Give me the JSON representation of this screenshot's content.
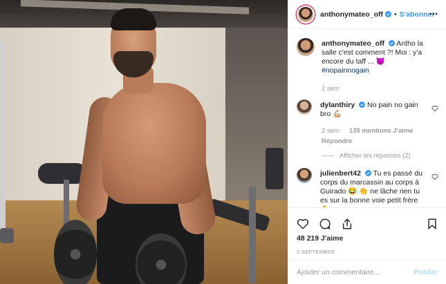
{
  "post": {
    "author": "anthonymateo_off",
    "dot": "•",
    "follow_label": "S'abonner",
    "caption": {
      "user": "anthonymateo_off",
      "text": "Antho la salle c'est comment ?! Moi : y'a encore du taff ... 😈",
      "hashtag": "#nopainnogain",
      "time": "2 sem"
    },
    "comments": [
      {
        "user": "dylanthiry",
        "text": "No pain no gain bro 💪🏼",
        "time": "2 sem",
        "likes": "135 mentions J'aime",
        "reply_label": "Répondre",
        "replies_label": "Afficher les réponses (2)"
      },
      {
        "user": "julienbert42",
        "text": "Tu es passé du corps du marcassin au corps à Guirado 😂 👏 ne lâche rien tu es sur la bonne voie petit frère 💪"
      }
    ],
    "likes": "48 219 J'aime",
    "date": "3 SEPTEMBRE",
    "add_comment_placeholder": "Ajouter un commentaire...",
    "publish_label": "Publier",
    "colors": {
      "accent": "#3897f0",
      "publish_disabled": "#b2dffc",
      "muted": "#999999",
      "hashtag": "#003569"
    },
    "icons": [
      "more-icon",
      "verified-icon",
      "heart-icon",
      "comment-icon",
      "share-icon",
      "bookmark-icon"
    ]
  }
}
